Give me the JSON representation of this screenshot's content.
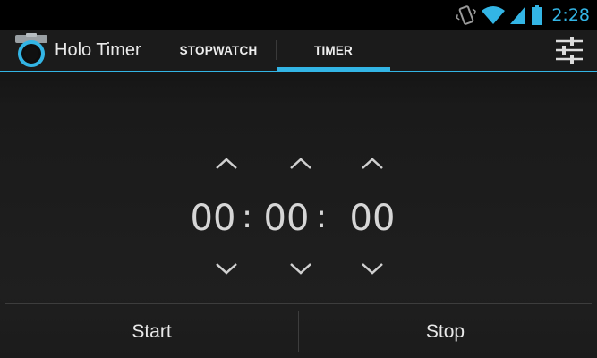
{
  "status_bar": {
    "time": "2:28",
    "icons": [
      "vibrate-icon",
      "wifi-icon",
      "signal-icon",
      "battery-icon"
    ]
  },
  "action_bar": {
    "title": "Holo Timer",
    "app_icon": "stopwatch-icon",
    "tabs": [
      {
        "label": "STOPWATCH",
        "selected": false
      },
      {
        "label": "TIMER",
        "selected": true
      }
    ],
    "settings_icon": "settings-sliders-icon"
  },
  "timer": {
    "hours": "00",
    "minutes": "00",
    "seconds": "00",
    "separator_1": ":",
    "separator_2": ":"
  },
  "buttons": {
    "start": "Start",
    "stop": "Stop"
  },
  "colors": {
    "accent": "#33b5e5",
    "background": "#1b1b1b",
    "text": "#e6e6e6"
  }
}
